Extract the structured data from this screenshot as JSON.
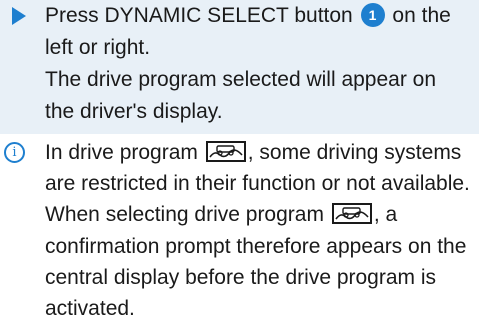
{
  "step": {
    "text_before": "Press DYNAMIC SELECT button",
    "badge": "1",
    "text_after": "on the left or right.",
    "result": "The drive program selected will appear on the driver's display."
  },
  "note": {
    "part1": "In drive program",
    "part2": ", some driving systems are restricted in their function or not available. When selecting drive program",
    "part3": ", a confirmation prompt therefore appears on the central display before the drive program is activated.",
    "drive_program_icon": "offroad-terrain-icon",
    "info_icon": "info-icon"
  },
  "colors": {
    "accent": "#1e7fcf",
    "step_background": "#e8f0f7",
    "text": "#1a1a1a"
  }
}
